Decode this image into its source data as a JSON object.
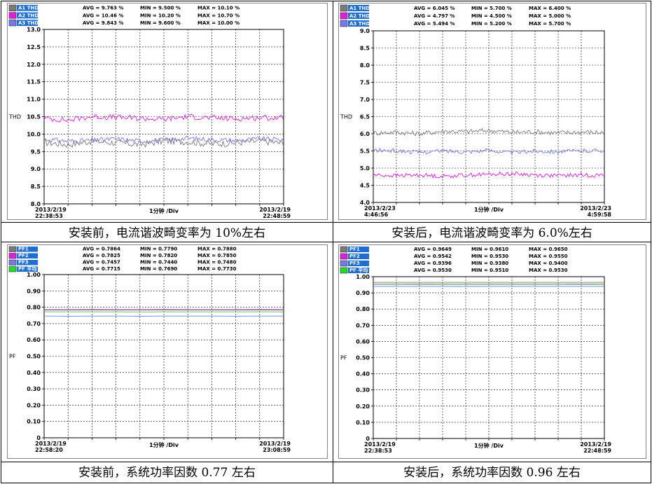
{
  "captions": [
    "安装前，电流谐波畸变率为 10%左右",
    "安装后，电流谐波畸变率为 6.0%左右",
    "安装前，系统功率因数 0.77 左右",
    "安装后，系统功率因数 0.96 左右"
  ],
  "chart_data": [
    {
      "type": "line",
      "ylabel": "THD",
      "xlabel": "1分钟 /Div",
      "x_start": "2013/2/19 22:38:53",
      "x_end": "2013/2/19 22:48:59",
      "x_start_date": "2013/2/19",
      "x_start_time": "22:38:53",
      "x_end_date": "2013/2/19",
      "x_end_time": "22:48:59",
      "ylim": [
        8.0,
        13.0
      ],
      "yticks": [
        "13.0",
        "12.5",
        "12.0",
        "11.5",
        "11.0",
        "10.5",
        "10.0",
        "9.5",
        "9.0",
        "8.5",
        "8.0"
      ],
      "grid": true,
      "series": [
        {
          "name": "A1 THD",
          "color": "#7a7a7a",
          "avg": "AVG = 9.763 %",
          "min": "MIN = 9.500 %",
          "max": "MAX = 10.10 %",
          "values": [
            9.76,
            9.7,
            9.8,
            9.75,
            9.7,
            9.8,
            9.78,
            9.72,
            9.75,
            9.8,
            9.74
          ]
        },
        {
          "name": "A2 THD",
          "color": "#e01ee0",
          "avg": "AVG = 10.46 %",
          "min": "MIN = 10.20 %",
          "max": "MAX = 10.70 %",
          "values": [
            10.45,
            10.4,
            10.5,
            10.48,
            10.45,
            10.42,
            10.5,
            10.46,
            10.44,
            10.47,
            10.46
          ]
        },
        {
          "name": "A3 THD",
          "color": "#7878e8",
          "avg": "AVG = 9.843 %",
          "min": "MIN = 9.600 %",
          "max": "MAX = 10.00 %",
          "values": [
            9.85,
            9.8,
            9.82,
            9.86,
            9.8,
            9.83,
            9.88,
            9.84,
            9.82,
            9.86,
            9.84
          ]
        }
      ]
    },
    {
      "type": "line",
      "ylabel": "THD",
      "xlabel": "1分钟 /Div",
      "x_start": "2013/2/23 4:46:56",
      "x_end": "2013/2/23 4:59:58",
      "x_start_date": "2013/2/23",
      "x_start_time": "4:46:56",
      "x_end_date": "2013/2/23",
      "x_end_time": "4:59:58",
      "ylim": [
        4.0,
        9.0
      ],
      "yticks": [
        "9.0",
        "8.5",
        "8.0",
        "7.5",
        "7.0",
        "6.5",
        "6.0",
        "5.5",
        "5.0",
        "4.5",
        "4.0"
      ],
      "grid": true,
      "series": [
        {
          "name": "A1 THD",
          "color": "#7a7a7a",
          "avg": "AVG = 6.045 %",
          "min": "MIN = 5.700 %",
          "max": "MAX = 6.400 %",
          "values": [
            6.02,
            6.05,
            6.0,
            6.08,
            6.06,
            6.1,
            6.04,
            6.06,
            6.03,
            6.05,
            6.04
          ]
        },
        {
          "name": "A2 THD",
          "color": "#e01ee0",
          "avg": "AVG = 4.797 %",
          "min": "MIN = 4.500 %",
          "max": "MAX = 5.000 %",
          "values": [
            4.8,
            4.78,
            4.8,
            4.76,
            4.8,
            4.82,
            4.84,
            4.8,
            4.78,
            4.8,
            4.79
          ]
        },
        {
          "name": "A3 THD",
          "color": "#7878e8",
          "avg": "AVG = 5.494 %",
          "min": "MIN = 5.200 %",
          "max": "MAX = 5.700 %",
          "values": [
            5.52,
            5.5,
            5.46,
            5.5,
            5.48,
            5.52,
            5.45,
            5.5,
            5.48,
            5.5,
            5.52
          ]
        }
      ]
    },
    {
      "type": "line",
      "ylabel": "PF",
      "xlabel": "1分钟 /Div",
      "x_start": "2013/2/19 22:58:20",
      "x_end": "2013/2/19 23:08:59",
      "x_start_date": "2013/2/19",
      "x_start_time": "22:58:20",
      "x_end_date": "2013/2/19",
      "x_end_time": "23:08:59",
      "ylim": [
        0,
        1.0
      ],
      "yticks": [
        "1.00",
        "0.90",
        "0.80",
        "0.70",
        "0.60",
        "0.50",
        "0.40",
        "0.30",
        "0.20",
        "0.10",
        "0"
      ],
      "grid": true,
      "series": [
        {
          "name": "PF1",
          "color": "#7a7a7a",
          "avg": "AVG = 0.7864",
          "min": "MIN = 0.7790",
          "max": "MAX = 0.7880",
          "values": [
            0.786,
            0.786,
            0.787,
            0.786,
            0.786,
            0.787,
            0.786,
            0.786,
            0.786,
            0.787,
            0.786
          ]
        },
        {
          "name": "PF2",
          "color": "#e01ee0",
          "avg": "AVG = 0.7825",
          "min": "MIN = 0.7820",
          "max": "MAX = 0.7850",
          "values": [
            0.7825,
            0.7825,
            0.7826,
            0.7825,
            0.7825,
            0.7825,
            0.7826,
            0.7825,
            0.7825,
            0.7825,
            0.7825
          ]
        },
        {
          "name": "PF3",
          "color": "#7878e8",
          "avg": "AVG = 0.7457",
          "min": "MIN = 0.7440",
          "max": "MAX = 0.7480",
          "values": [
            0.746,
            0.745,
            0.746,
            0.746,
            0.745,
            0.746,
            0.746,
            0.746,
            0.745,
            0.746,
            0.746
          ]
        },
        {
          "name": "PF 平均",
          "color": "#22dd22",
          "avg": "AVG = 0.7715",
          "min": "MIN = 0.7690",
          "max": "MAX = 0.7730",
          "values": [
            0.7715,
            0.7715,
            0.7716,
            0.7715,
            0.7714,
            0.7715,
            0.7716,
            0.7715,
            0.7715,
            0.7715,
            0.7715
          ]
        }
      ]
    },
    {
      "type": "line",
      "ylabel": "PF",
      "xlabel": "1分钟 /Div",
      "x_start": "2013/2/19 22:38:53",
      "x_end": "2013/2/19 22:48:59",
      "x_start_date": "2013/2/19",
      "x_start_time": "22:38:53",
      "x_end_date": "2013/2/19",
      "x_end_time": "22:48:59",
      "ylim": [
        0,
        1.0
      ],
      "yticks": [
        "1.00",
        "0.90",
        "0.80",
        "0.70",
        "0.60",
        "0.50",
        "0.40",
        "0.30",
        "0.20",
        "0.10",
        "0"
      ],
      "grid": true,
      "series": [
        {
          "name": "PF1",
          "color": "#7a7a7a",
          "avg": "AVG = 0.9649",
          "min": "MIN = 0.9610",
          "max": "MAX = 0.9650",
          "values": [
            0.965,
            0.965,
            0.965,
            0.965,
            0.965,
            0.965,
            0.965,
            0.965,
            0.965,
            0.965,
            0.965
          ]
        },
        {
          "name": "PF2",
          "color": "#e01ee0",
          "avg": "AVG = 0.9542",
          "min": "MIN = 0.9530",
          "max": "MAX = 0.9550",
          "values": [
            0.954,
            0.954,
            0.955,
            0.954,
            0.954,
            0.954,
            0.954,
            0.954,
            0.954,
            0.955,
            0.954
          ]
        },
        {
          "name": "PF3",
          "color": "#7878e8",
          "avg": "AVG = 0.9396",
          "min": "MIN = 0.9380",
          "max": "MAX = 0.9400",
          "values": [
            0.94,
            0.94,
            0.94,
            0.94,
            0.939,
            0.94,
            0.94,
            0.94,
            0.94,
            0.94,
            0.94
          ]
        },
        {
          "name": "PF 平均",
          "color": "#22dd22",
          "avg": "AVG = 0.9530",
          "min": "MIN = 0.9510",
          "max": "MAX = 0.9530",
          "values": [
            0.953,
            0.953,
            0.953,
            0.953,
            0.953,
            0.953,
            0.953,
            0.953,
            0.953,
            0.953,
            0.953
          ]
        }
      ]
    }
  ]
}
